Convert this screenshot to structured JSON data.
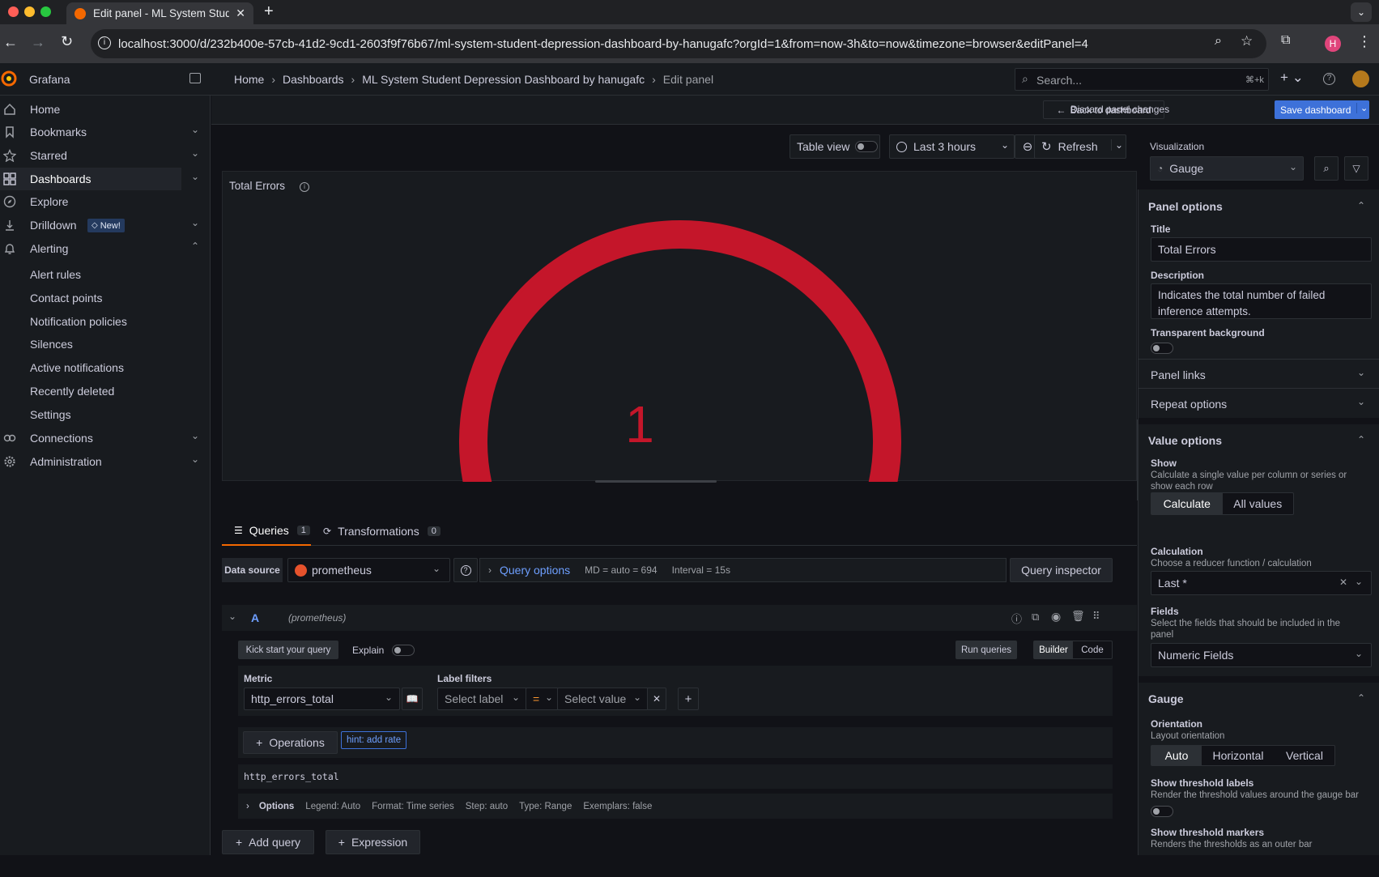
{
  "browser": {
    "tab_title": "Edit panel - ML System Stude",
    "url": "localhost:3000/d/232b400e-57cb-41d2-9cd1-2603f9f76b67/ml-system-student-depression-dashboard-by-hanugafc?orgId=1&from=now-3h&to=now&timezone=browser&editPanel=4",
    "profile_initial": "H"
  },
  "app": {
    "name": "Grafana",
    "search_placeholder": "Search...",
    "search_shortcut": "⌘+k"
  },
  "breadcrumb": [
    "Home",
    "Dashboards",
    "ML System Student Depression Dashboard by hanugafc",
    "Edit panel"
  ],
  "sidebar": {
    "items": [
      {
        "label": "Home",
        "icon": "home-icon"
      },
      {
        "label": "Bookmarks",
        "icon": "bookmark-icon"
      },
      {
        "label": "Starred",
        "icon": "star-icon"
      },
      {
        "label": "Dashboards",
        "icon": "apps-icon"
      },
      {
        "label": "Explore",
        "icon": "compass-icon"
      },
      {
        "label": "Drilldown",
        "icon": "drilldown-icon",
        "badge": "New!"
      },
      {
        "label": "Alerting",
        "icon": "bell-icon"
      },
      {
        "label": "Connections",
        "icon": "connections-icon"
      },
      {
        "label": "Administration",
        "icon": "cog-icon"
      }
    ],
    "alerting_children": [
      "Alert rules",
      "Contact points",
      "Notification policies",
      "Silences",
      "Active notifications",
      "Recently deleted",
      "Settings"
    ]
  },
  "toolbar": {
    "back": "Back to dashboard",
    "discard": "Discard panel changes",
    "save": "Save dashboard"
  },
  "panel_toolbar": {
    "table_view": "Table view",
    "time_range": "Last 3 hours",
    "refresh": "Refresh"
  },
  "panel": {
    "title": "Total Errors",
    "value": "1",
    "gauge_fraction": 1,
    "gauge_color": "#c4162a"
  },
  "tabs": {
    "queries_label": "Queries",
    "queries_count": "1",
    "transformations_label": "Transformations",
    "transformations_count": "0"
  },
  "datasource": {
    "label": "Data source",
    "value": "prometheus",
    "query_options": "Query options",
    "md": "MD = auto = 694",
    "interval": "Interval = 15s",
    "inspector": "Query inspector"
  },
  "query": {
    "ref": "A",
    "ds": "(prometheus)",
    "kick_start": "Kick start your query",
    "explain": "Explain",
    "run": "Run queries",
    "builder": "Builder",
    "code": "Code",
    "metric_label": "Metric",
    "metric_value": "http_errors_total",
    "label_filters": "Label filters",
    "select_label": "Select label",
    "operator": "=",
    "select_value": "Select value",
    "operations": "Operations",
    "hint": "hint: add rate",
    "preview": "http_errors_total",
    "options_label": "Options",
    "options_summary": [
      "Legend: Auto",
      "Format: Time series",
      "Step: auto",
      "Type: Range",
      "Exemplars: false"
    ],
    "add_query": "Add query",
    "expression": "Expression"
  },
  "options": {
    "visualization_label": "Visualization",
    "visualization": "Gauge",
    "panel_options": "Panel options",
    "title_label": "Title",
    "title_value": "Total Errors",
    "description_label": "Description",
    "description_value": "Indicates the total number of failed inference attempts.",
    "transparent_label": "Transparent background",
    "panel_links": "Panel links",
    "repeat_options": "Repeat options",
    "value_options": "Value options",
    "show_label": "Show",
    "show_desc": "Calculate a single value per column or series or show each row",
    "show_calculate": "Calculate",
    "show_all": "All values",
    "calc_label": "Calculation",
    "calc_desc": "Choose a reducer function / calculation",
    "calc_value": "Last *",
    "fields_label": "Fields",
    "fields_desc": "Select the fields that should be included in the panel",
    "fields_value": "Numeric Fields",
    "gauge_section": "Gauge",
    "orientation_label": "Orientation",
    "orientation_desc": "Layout orientation",
    "orient_auto": "Auto",
    "orient_h": "Horizontal",
    "orient_v": "Vertical",
    "thresh_labels": "Show threshold labels",
    "thresh_labels_desc": "Render the threshold values around the gauge bar",
    "thresh_markers": "Show threshold markers",
    "thresh_markers_desc": "Renders the thresholds as an outer bar"
  }
}
